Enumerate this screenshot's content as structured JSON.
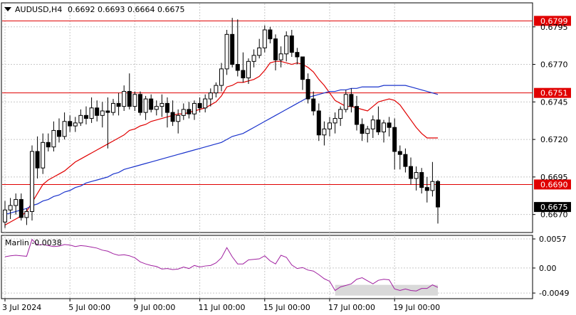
{
  "header": {
    "symbol": "AUDUSD,H4",
    "ohlc": "0.6692 0.6693 0.6664 0.6675"
  },
  "indicator_label": "Marlin -0.0038",
  "colors": {
    "background": "#ffffff",
    "grid": "#c8c8c8",
    "candle": "#000000",
    "ma_fast": "#e00000",
    "ma_slow": "#1a33cc",
    "level_line": "#e00000",
    "level_tag": "#e00000",
    "price_tag": "#000000",
    "oscillator": "#a020a0",
    "highlight_box": "#d9d9d9"
  },
  "chart_data": [
    {
      "type": "candlestick",
      "title": "AUDUSD,H4",
      "ylim": [
        0.6658,
        0.6811
      ],
      "y_ticks": [
        "0.6795",
        "0.6770",
        "0.6745",
        "0.6720",
        "0.6695",
        "0.6670"
      ],
      "x_labels": [
        "3 Jul 2024",
        "5 Jul 00:00",
        "9 Jul 00:00",
        "11 Jul 00:00",
        "15 Jul 00:00",
        "17 Jul 00:00",
        "19 Jul 00:00"
      ],
      "grid": "on",
      "horizontal_levels": [
        {
          "value": 0.6799,
          "label": "0.6799"
        },
        {
          "value": 0.6751,
          "label": "0.6751"
        },
        {
          "value": 0.669,
          "label": "0.6690"
        }
      ],
      "last_price": {
        "value": 0.6675,
        "label": "0.6675"
      },
      "candles": [
        [
          0.6665,
          0.6679,
          0.6661,
          0.6673
        ],
        [
          0.6673,
          0.6681,
          0.6667,
          0.6676
        ],
        [
          0.6676,
          0.6684,
          0.667,
          0.668
        ],
        [
          0.668,
          0.6684,
          0.6666,
          0.6668
        ],
        [
          0.6668,
          0.6674,
          0.6663,
          0.6672
        ],
        [
          0.6672,
          0.6716,
          0.6666,
          0.6712
        ],
        [
          0.6712,
          0.6722,
          0.6694,
          0.6701
        ],
        [
          0.6701,
          0.6724,
          0.6697,
          0.6718
        ],
        [
          0.6718,
          0.6724,
          0.6712,
          0.6715
        ],
        [
          0.6715,
          0.6732,
          0.6712,
          0.6726
        ],
        [
          0.6726,
          0.6734,
          0.6718,
          0.6722
        ],
        [
          0.6722,
          0.6738,
          0.672,
          0.6732
        ],
        [
          0.6732,
          0.6736,
          0.6725,
          0.6729
        ],
        [
          0.6729,
          0.6735,
          0.6725,
          0.6731
        ],
        [
          0.6731,
          0.674,
          0.6729,
          0.6736
        ],
        [
          0.6736,
          0.6742,
          0.673,
          0.6734
        ],
        [
          0.6734,
          0.6748,
          0.6731,
          0.6741
        ],
        [
          0.6741,
          0.6746,
          0.6732,
          0.6736
        ],
        [
          0.6736,
          0.6745,
          0.6728,
          0.6739
        ],
        [
          0.6739,
          0.6748,
          0.6714,
          0.6738
        ],
        [
          0.6738,
          0.6747,
          0.6736,
          0.6744
        ],
        [
          0.6744,
          0.6751,
          0.6736,
          0.6742
        ],
        [
          0.6742,
          0.6756,
          0.6739,
          0.6752
        ],
        [
          0.6752,
          0.6764,
          0.674,
          0.6742
        ],
        [
          0.6742,
          0.6752,
          0.6739,
          0.675
        ],
        [
          0.675,
          0.6752,
          0.6736,
          0.6738
        ],
        [
          0.6738,
          0.6749,
          0.6733,
          0.6747
        ],
        [
          0.6747,
          0.675,
          0.6738,
          0.674
        ],
        [
          0.674,
          0.6746,
          0.6736,
          0.6742
        ],
        [
          0.6742,
          0.675,
          0.6735,
          0.6744
        ],
        [
          0.6744,
          0.6748,
          0.6728,
          0.6738
        ],
        [
          0.6738,
          0.6746,
          0.6729,
          0.6732
        ],
        [
          0.6732,
          0.674,
          0.6724,
          0.6736
        ],
        [
          0.6736,
          0.6744,
          0.6733,
          0.674
        ],
        [
          0.674,
          0.6745,
          0.6734,
          0.6737
        ],
        [
          0.6737,
          0.6746,
          0.6733,
          0.6744
        ],
        [
          0.6744,
          0.6748,
          0.6738,
          0.6741
        ],
        [
          0.6741,
          0.675,
          0.6738,
          0.6747
        ],
        [
          0.6747,
          0.6754,
          0.6742,
          0.6751
        ],
        [
          0.6751,
          0.6758,
          0.6748,
          0.6756
        ],
        [
          0.6756,
          0.6771,
          0.6752,
          0.6767
        ],
        [
          0.6767,
          0.6793,
          0.6763,
          0.679
        ],
        [
          0.679,
          0.6801,
          0.6768,
          0.677
        ],
        [
          0.677,
          0.68,
          0.6762,
          0.6766
        ],
        [
          0.6766,
          0.6778,
          0.6758,
          0.6761
        ],
        [
          0.6761,
          0.6774,
          0.6757,
          0.6772
        ],
        [
          0.6772,
          0.678,
          0.6768,
          0.6776
        ],
        [
          0.6776,
          0.6787,
          0.6774,
          0.6781
        ],
        [
          0.6781,
          0.6796,
          0.6778,
          0.6793
        ],
        [
          0.6793,
          0.6795,
          0.6784,
          0.6787
        ],
        [
          0.6787,
          0.679,
          0.6766,
          0.6773
        ],
        [
          0.6773,
          0.6782,
          0.6768,
          0.6777
        ],
        [
          0.6777,
          0.6792,
          0.6772,
          0.6789
        ],
        [
          0.6789,
          0.6793,
          0.6775,
          0.6778
        ],
        [
          0.6778,
          0.6781,
          0.677,
          0.6775
        ],
        [
          0.6775,
          0.6772,
          0.6753,
          0.676
        ],
        [
          0.676,
          0.6764,
          0.6744,
          0.6747
        ],
        [
          0.6747,
          0.6752,
          0.6736,
          0.6739
        ],
        [
          0.6739,
          0.6744,
          0.6719,
          0.6723
        ],
        [
          0.6723,
          0.6732,
          0.6716,
          0.6727
        ],
        [
          0.6727,
          0.6735,
          0.6722,
          0.6731
        ],
        [
          0.6731,
          0.6738,
          0.6724,
          0.6734
        ],
        [
          0.6734,
          0.6742,
          0.6729,
          0.674
        ],
        [
          0.674,
          0.6753,
          0.6738,
          0.675
        ],
        [
          0.675,
          0.6754,
          0.6738,
          0.6742
        ],
        [
          0.6742,
          0.6749,
          0.6726,
          0.673
        ],
        [
          0.673,
          0.6734,
          0.6719,
          0.6724
        ],
        [
          0.6724,
          0.6729,
          0.6718,
          0.6727
        ],
        [
          0.6727,
          0.6736,
          0.6721,
          0.6733
        ],
        [
          0.6733,
          0.6742,
          0.6723,
          0.6725
        ],
        [
          0.6725,
          0.6733,
          0.6718,
          0.6731
        ],
        [
          0.6731,
          0.6735,
          0.6722,
          0.6728
        ],
        [
          0.6728,
          0.6734,
          0.67,
          0.6712
        ],
        [
          0.6712,
          0.6716,
          0.67,
          0.671
        ],
        [
          0.671,
          0.6714,
          0.6698,
          0.6702
        ],
        [
          0.6702,
          0.6708,
          0.669,
          0.6694
        ],
        [
          0.6694,
          0.6702,
          0.6686,
          0.6698
        ],
        [
          0.6698,
          0.6701,
          0.6684,
          0.6688
        ],
        [
          0.6688,
          0.6695,
          0.6678,
          0.6686
        ],
        [
          0.6686,
          0.6705,
          0.6682,
          0.6692
        ],
        [
          0.6692,
          0.6693,
          0.6664,
          0.6675
        ]
      ],
      "series": [
        {
          "name": "",
          "color": "#e00000",
          "values": [
            0.6663,
            0.6665,
            0.6667,
            0.6669,
            0.6672,
            0.6678,
            0.6684,
            0.669,
            0.6693,
            0.6695,
            0.6697,
            0.6699,
            0.6702,
            0.6705,
            0.6707,
            0.6709,
            0.6711,
            0.6713,
            0.6715,
            0.6717,
            0.6719,
            0.6721,
            0.6723,
            0.6726,
            0.6727,
            0.6729,
            0.673,
            0.6732,
            0.6733,
            0.6734,
            0.6735,
            0.6736,
            0.6737,
            0.6737,
            0.6738,
            0.6739,
            0.674,
            0.6741,
            0.6743,
            0.6745,
            0.6749,
            0.6755,
            0.6756,
            0.6758,
            0.6758,
            0.6759,
            0.676,
            0.6762,
            0.6766,
            0.6771,
            0.6772,
            0.6772,
            0.6771,
            0.677,
            0.6771,
            0.677,
            0.6768,
            0.6765,
            0.676,
            0.6756,
            0.6751,
            0.6746,
            0.6744,
            0.6742,
            0.6742,
            0.6741,
            0.674,
            0.6739,
            0.6742,
            0.6745,
            0.6746,
            0.6747,
            0.6746,
            0.6743,
            0.6738,
            0.6733,
            0.6728,
            0.6724,
            0.6721,
            0.6721,
            0.6721
          ]
        },
        {
          "name": "",
          "color": "#1a33cc",
          "values": [
            0.667,
            0.6671,
            0.6672,
            0.6673,
            0.6674,
            0.6676,
            0.6677,
            0.6679,
            0.668,
            0.6682,
            0.6683,
            0.6685,
            0.6686,
            0.6688,
            0.6689,
            0.6691,
            0.6692,
            0.6693,
            0.6694,
            0.6695,
            0.6697,
            0.6698,
            0.67,
            0.6701,
            0.6702,
            0.6703,
            0.6704,
            0.6705,
            0.6706,
            0.6707,
            0.6708,
            0.6709,
            0.671,
            0.6711,
            0.6712,
            0.6713,
            0.6714,
            0.6715,
            0.6716,
            0.6717,
            0.6718,
            0.672,
            0.6722,
            0.6723,
            0.6724,
            0.6726,
            0.6728,
            0.673,
            0.6732,
            0.6734,
            0.6736,
            0.6738,
            0.674,
            0.6742,
            0.6744,
            0.6746,
            0.6748,
            0.6749,
            0.675,
            0.6751,
            0.6752,
            0.6752,
            0.6753,
            0.6753,
            0.6754,
            0.6754,
            0.6755,
            0.6755,
            0.6755,
            0.6755,
            0.6756,
            0.6756,
            0.6756,
            0.6756,
            0.6756,
            0.6755,
            0.6754,
            0.6753,
            0.6752,
            0.6751,
            0.675
          ]
        }
      ]
    },
    {
      "type": "line",
      "title": "Marlin -0.0038",
      "ylim": [
        -0.006,
        0.0064
      ],
      "y_ticks": [
        "0.0057",
        "0.00",
        "-0.0049"
      ],
      "grid": "on",
      "series": [
        {
          "name": "Marlin",
          "color": "#a020a0",
          "values": [
            0.0022,
            0.0024,
            0.0025,
            0.0024,
            0.0023,
            0.0056,
            0.0045,
            0.0046,
            0.0044,
            0.0042,
            0.0043,
            0.0046,
            0.0045,
            0.0042,
            0.0044,
            0.0043,
            0.0041,
            0.0039,
            0.0035,
            0.0033,
            0.0028,
            0.0025,
            0.0026,
            0.0024,
            0.002,
            0.0012,
            0.0008,
            0.0005,
            0.0003,
            -0.0002,
            -0.0001,
            -0.0003,
            -0.0002,
            0.0002,
            -0.0001,
            0.0005,
            0.0002,
            0.0004,
            0.0005,
            0.001,
            0.002,
            0.004,
            0.0022,
            0.0008,
            0.0008,
            0.0016,
            0.0017,
            0.0018,
            0.0024,
            0.0014,
            0.0008,
            0.0025,
            0.0021,
            0.0006,
            -0.0001,
            0.0001,
            -0.0004,
            -0.0006,
            -0.0013,
            -0.0021,
            -0.0026,
            -0.0044,
            -0.0037,
            -0.0034,
            -0.0031,
            -0.0022,
            -0.0019,
            -0.0025,
            -0.0031,
            -0.0024,
            -0.0022,
            -0.0023,
            -0.0041,
            -0.0044,
            -0.0041,
            -0.0044,
            -0.0045,
            -0.004,
            -0.004,
            -0.0033,
            -0.0038
          ]
        }
      ],
      "highlight_range": {
        "x_from": 61,
        "x_to": 80,
        "y_from": -0.0054,
        "y_to": -0.0033
      }
    }
  ]
}
